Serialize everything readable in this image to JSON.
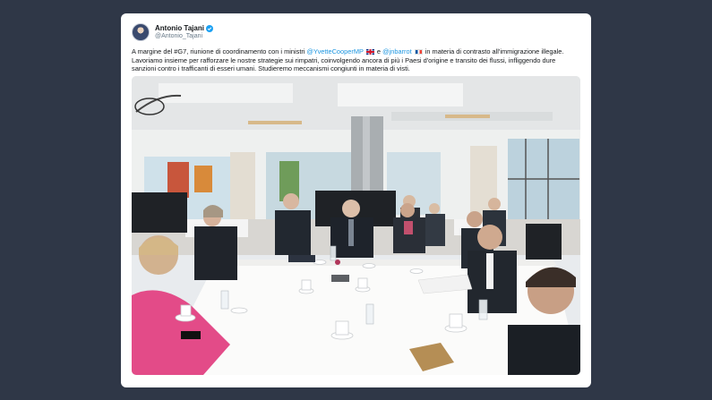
{
  "tweet": {
    "author": {
      "display_name": "Antonio Tajani",
      "handle": "@Antonio_Tajani",
      "verified": true
    },
    "text": {
      "part1": "A margine del #G7, riunione di coordinamento con i ministri ",
      "mention1": "@YvetteCooperMP",
      "part2": " e ",
      "mention2": "@jnbarrot",
      "part3": " in materia di contrasto all'immigrazione illegale. Lavoriamo insieme per rafforzare le nostre strategie sui rimpatri, coinvolgendo ancora di più i Paesi d'origine e transito dei flussi, infliggendo dure sanzioni contro i trafficanti di esseri umani. Studieremo meccanismi congiunti in materia di visti."
    },
    "flags": [
      "flag-uk-icon",
      "flag-fr-icon"
    ],
    "photo": {
      "alt_icon": "meeting-photo"
    }
  },
  "colors": {
    "page_background": "#2f3747",
    "card_background": "#ffffff",
    "mention": "#1b95e0",
    "verified": "#1da1f2"
  }
}
